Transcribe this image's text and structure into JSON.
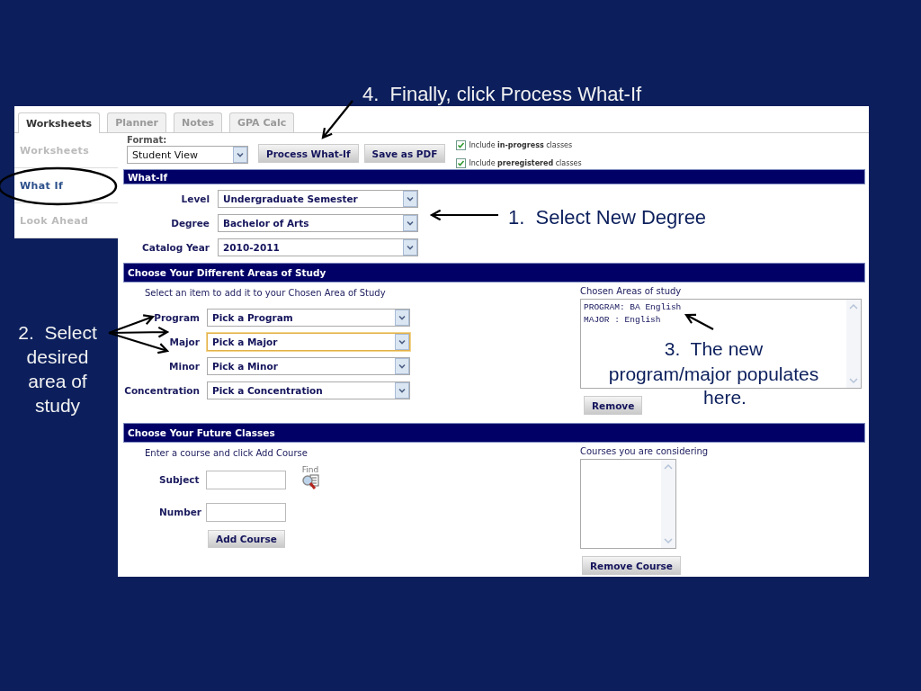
{
  "tabs": [
    {
      "label": "Worksheets",
      "selected": true
    },
    {
      "label": "Planner",
      "selected": false
    },
    {
      "label": "Notes",
      "selected": false
    },
    {
      "label": "GPA Calc",
      "selected": false
    }
  ],
  "sidebar": {
    "items": [
      {
        "label": "Worksheets",
        "selected": false
      },
      {
        "label": "What If",
        "selected": true
      },
      {
        "label": "Look Ahead",
        "selected": false
      }
    ]
  },
  "toolbar": {
    "format_label": "Format:",
    "format_value": "Student View",
    "buttons": [
      "Process What-If",
      "Save as PDF"
    ],
    "options": [
      {
        "label": "Include **in-progress** classes",
        "checked": true
      },
      {
        "label": "Include **preregistered** classes",
        "checked": true
      }
    ]
  },
  "what_if": {
    "title": "What-If",
    "fields": [
      {
        "label": "Level",
        "value": "Undergraduate Semester"
      },
      {
        "label": "Degree",
        "value": "Bachelor of Arts"
      },
      {
        "label": "Catalog Year",
        "value": "2010-2011"
      }
    ]
  },
  "areas": {
    "title": "Choose Your Different Areas of Study",
    "hint": "Select an item to add it to your Chosen Area of Study",
    "fields": [
      {
        "label": "Program",
        "value": "Pick a Program",
        "focused": false
      },
      {
        "label": "Major",
        "value": "Pick a Major",
        "focused": true
      },
      {
        "label": "Minor",
        "value": "Pick a Minor",
        "focused": false
      },
      {
        "label": "Concentration",
        "value": "Pick a Concentration",
        "focused": false
      }
    ],
    "chosen_label": "Chosen Areas of study",
    "chosen_items": [
      "PROGRAM: BA English",
      "MAJOR : English"
    ],
    "remove_button": "Remove"
  },
  "future": {
    "title": "Choose Your Future Classes",
    "hint": "Enter a course and click Add Course",
    "fields": [
      {
        "label": "Subject"
      },
      {
        "label": "Number"
      }
    ],
    "find_label": "Find",
    "add_button": "Add Course",
    "courses_label": "Courses you are considering",
    "remove_button": "Remove Course"
  },
  "annotations": [
    {
      "text": "4.  Finally, click Process What-If"
    },
    {
      "text": "1.  Select New Degree"
    },
    {
      "text": "2.  Select\ndesired\narea of\nstudy"
    },
    {
      "text": "3.  The new",
      "lines": [
        "program/major populates",
        "here."
      ]
    }
  ]
}
